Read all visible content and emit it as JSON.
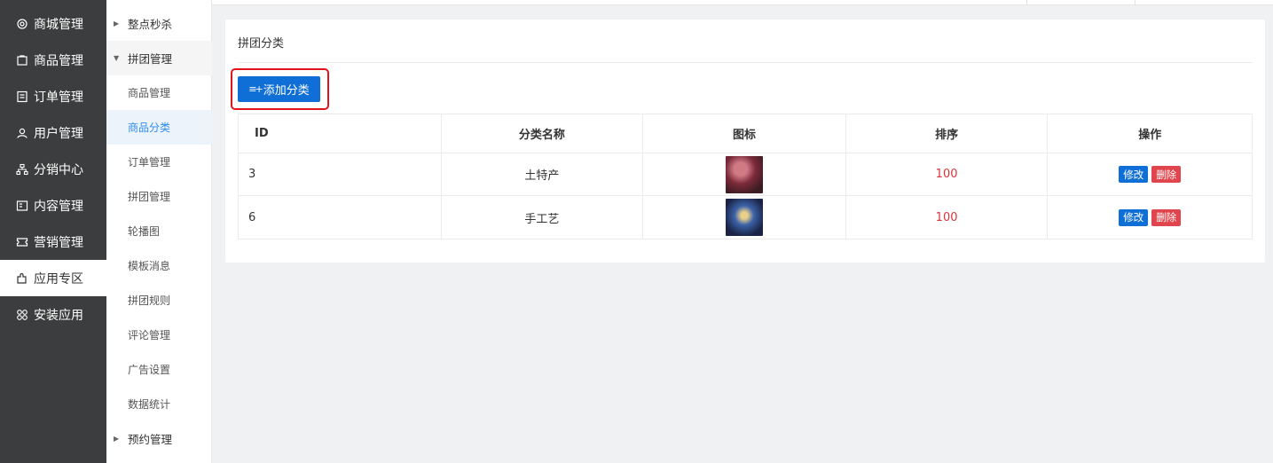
{
  "sidebar": {
    "items": [
      {
        "label": "商城管理",
        "icon": "gear-icon"
      },
      {
        "label": "商品管理",
        "icon": "bag-icon"
      },
      {
        "label": "订单管理",
        "icon": "order-icon"
      },
      {
        "label": "用户管理",
        "icon": "user-icon"
      },
      {
        "label": "分销中心",
        "icon": "network-icon"
      },
      {
        "label": "内容管理",
        "icon": "content-icon"
      },
      {
        "label": "营销管理",
        "icon": "ticket-icon"
      },
      {
        "label": "应用专区",
        "icon": "puzzle-icon",
        "active": true
      },
      {
        "label": "安装应用",
        "icon": "grid-icon"
      }
    ]
  },
  "submenu": {
    "items": [
      {
        "label": "整点秒杀",
        "type": "group",
        "expanded": false
      },
      {
        "label": "拼团管理",
        "type": "group",
        "expanded": true
      },
      {
        "label": "商品管理",
        "type": "child"
      },
      {
        "label": "商品分类",
        "type": "child",
        "selected": true
      },
      {
        "label": "订单管理",
        "type": "child"
      },
      {
        "label": "拼团管理",
        "type": "child"
      },
      {
        "label": "轮播图",
        "type": "child"
      },
      {
        "label": "模板消息",
        "type": "child"
      },
      {
        "label": "拼团规则",
        "type": "child"
      },
      {
        "label": "评论管理",
        "type": "child"
      },
      {
        "label": "广告设置",
        "type": "child"
      },
      {
        "label": "数据统计",
        "type": "child"
      },
      {
        "label": "预约管理",
        "type": "group",
        "expanded": false
      }
    ]
  },
  "panel": {
    "title": "拼团分类",
    "add_button": "添加分类",
    "add_icon": "≡+"
  },
  "table": {
    "columns": [
      "ID",
      "分类名称",
      "图标",
      "排序",
      "操作"
    ],
    "rows": [
      {
        "id": "3",
        "name": "土特产",
        "icon": "image-thumbnail",
        "sort": "100",
        "edit": "修改",
        "delete": "删除"
      },
      {
        "id": "6",
        "name": "手工艺",
        "icon": "image-thumbnail",
        "sort": "100",
        "edit": "修改",
        "delete": "删除"
      }
    ]
  },
  "colors": {
    "sidebar_bg": "#3c3d3e",
    "primary": "#0f6fd6",
    "danger": "#e0444c",
    "sort_value": "#d9363e",
    "highlight_border": "#e1141b"
  }
}
